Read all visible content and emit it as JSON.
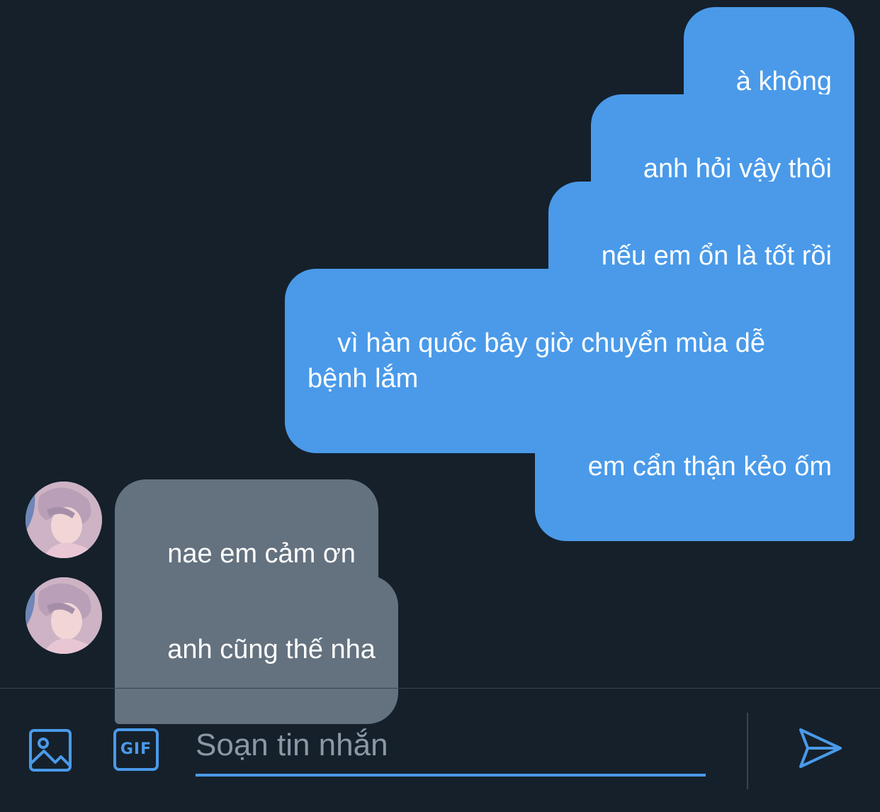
{
  "messages": [
    {
      "direction": "sent",
      "text": "à không"
    },
    {
      "direction": "sent",
      "text": "anh hỏi vậy thôi"
    },
    {
      "direction": "sent",
      "text": "nếu em ổn là tốt rồi"
    },
    {
      "direction": "sent",
      "text": "vì hàn quốc bây giờ chuyển mùa dễ\nbệnh lắm"
    },
    {
      "direction": "sent",
      "text": "em cẩn thận kẻo ốm"
    },
    {
      "direction": "received",
      "text": "nae em cảm ơn"
    },
    {
      "direction": "received",
      "text": "anh cũng thế nha"
    }
  ],
  "composer": {
    "placeholder": "Soạn tin nhắn",
    "gif_label": "GIF",
    "icons": [
      "image-icon",
      "gif-icon",
      "send-icon"
    ]
  },
  "colors": {
    "background": "#15202b",
    "sent_bubble": "#4a9ae9",
    "received_bubble": "#64717f",
    "accent": "#4a9ae9",
    "placeholder": "#8b98a5"
  }
}
